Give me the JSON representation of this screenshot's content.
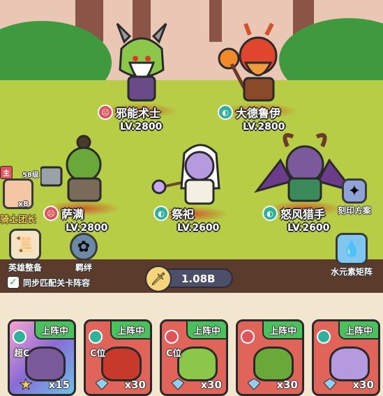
{
  "heroes": [
    {
      "name": "邪能术士",
      "level": "LV.2800",
      "affinity": "red"
    },
    {
      "name": "大德鲁伊",
      "level": "LV.2800",
      "affinity": "teal"
    },
    {
      "name": "萨满",
      "level": "LV.2800",
      "affinity": "red"
    },
    {
      "name": "祭祀",
      "level": "LV.2600",
      "affinity": "teal"
    },
    {
      "name": "怒风猎手",
      "level": "LV.2600",
      "affinity": "teal"
    }
  ],
  "captain": {
    "tag": "主",
    "level": "58级",
    "count": "x8",
    "title": "骑士团长"
  },
  "left_buttons": {
    "equip": "英雄整备",
    "bond": "羁绊"
  },
  "right_buttons": {
    "seal": "刻印方案",
    "matrix": "水元素矩阵"
  },
  "power": {
    "value": "1.08B"
  },
  "sync_text": "同步匹配关卡阵容",
  "cards": [
    {
      "status": "上阵中",
      "rank": "超C",
      "count": "x15",
      "bg": "#8a6bd6"
    },
    {
      "status": "上阵中",
      "rank": "C位",
      "count": "x30",
      "bg": "#e0645a"
    },
    {
      "status": "上阵中",
      "rank": "C位",
      "count": "x30",
      "bg": "#e0645a"
    },
    {
      "status": "上阵中",
      "rank": "",
      "count": "x30",
      "bg": "#e0645a"
    },
    {
      "status": "上阵中",
      "rank": "",
      "count": "x30",
      "bg": "#e0645a"
    }
  ],
  "colors": {
    "grass": "#b6cd45",
    "badge_red": "#e2525a",
    "badge_teal": "#2fb29c",
    "on_green": "#49c25d"
  }
}
